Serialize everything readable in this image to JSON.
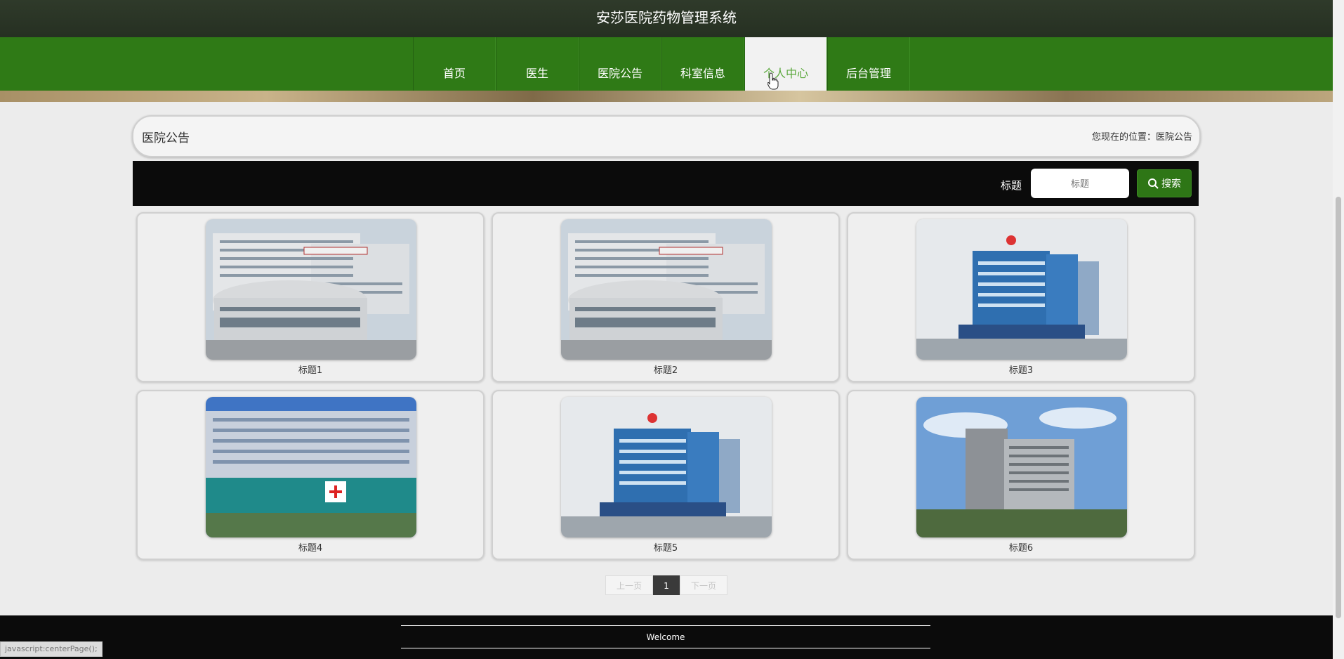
{
  "header": {
    "site_title": "安莎医院药物管理系统"
  },
  "nav": {
    "items": [
      {
        "label": "首页"
      },
      {
        "label": "医生"
      },
      {
        "label": "医院公告"
      },
      {
        "label": "科室信息"
      },
      {
        "label": "个人中心",
        "active": true
      },
      {
        "label": "后台管理"
      }
    ]
  },
  "page": {
    "title": "医院公告",
    "breadcrumb": "您现在的位置：医院公告"
  },
  "search": {
    "label": "标题",
    "placeholder": "标题",
    "button_label": "搜索"
  },
  "cards": [
    {
      "caption": "标题1",
      "image": "hospital-building-photo"
    },
    {
      "caption": "标题2",
      "image": "hospital-building-photo"
    },
    {
      "caption": "标题3",
      "image": "hospital-building-photo"
    },
    {
      "caption": "标题4",
      "image": "hospital-building-photo"
    },
    {
      "caption": "标题5",
      "image": "hospital-building-photo"
    },
    {
      "caption": "标题6",
      "image": "hospital-building-photo"
    }
  ],
  "pagination": {
    "prev": "上一页",
    "current": "1",
    "next": "下一页"
  },
  "footer": {
    "text": "Welcome"
  },
  "status_bar": {
    "text": "javascript:centerPage();"
  },
  "colors": {
    "nav_green": "#2f7a16",
    "active_tab_text": "#5aa83c",
    "search_button": "#2e7616"
  }
}
